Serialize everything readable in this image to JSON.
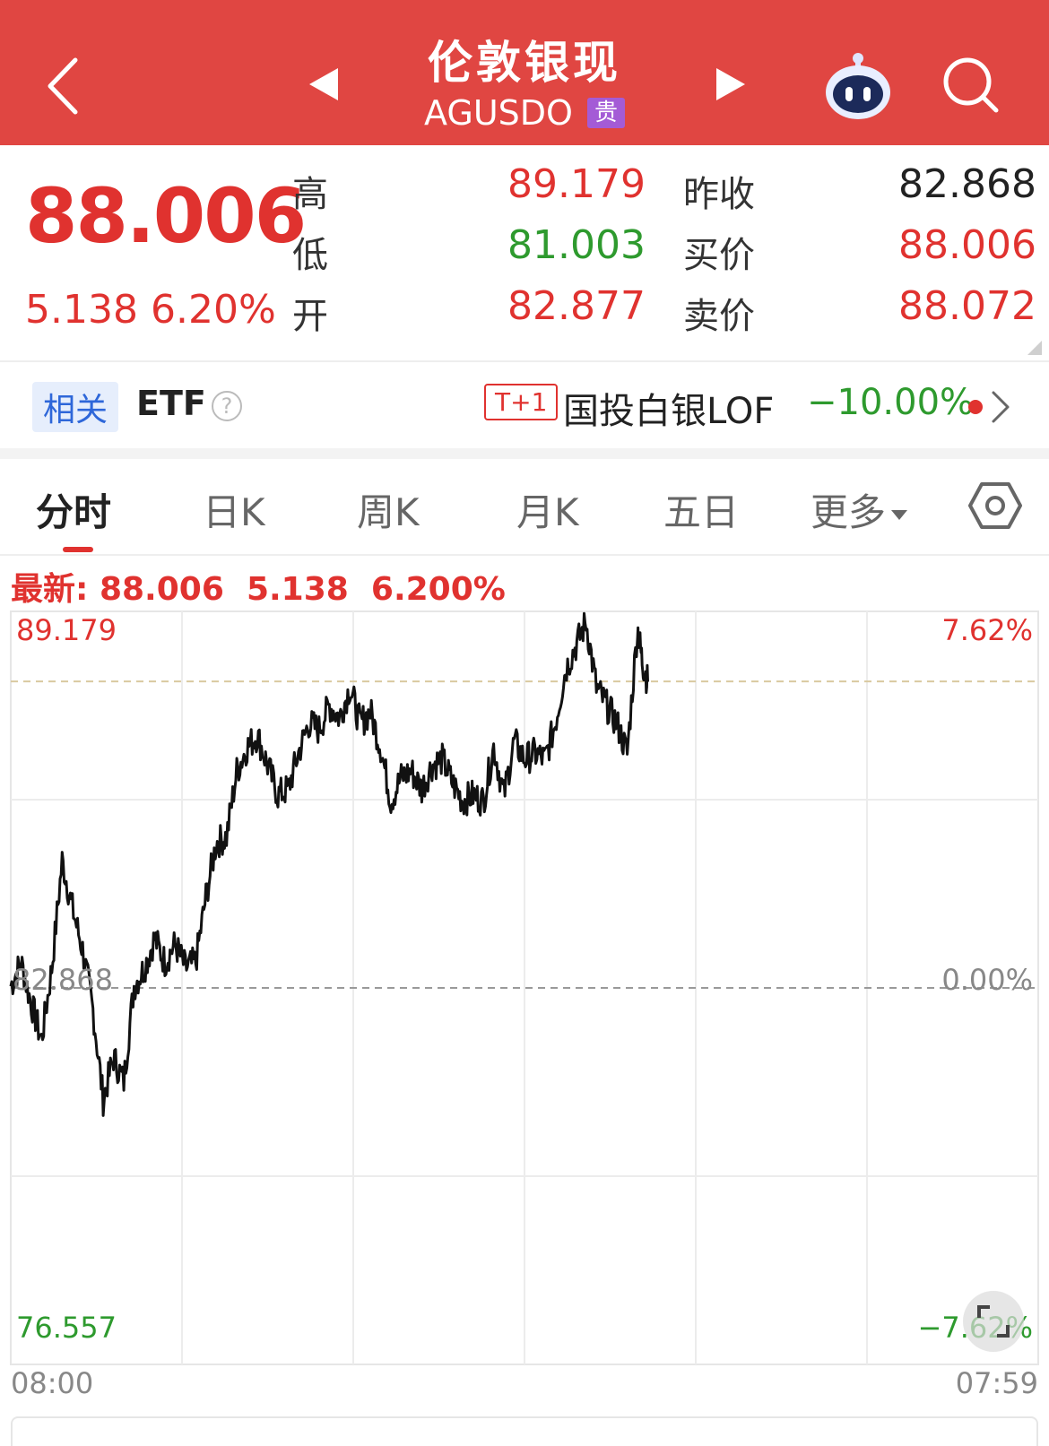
{
  "header": {
    "title": "伦敦银现",
    "code": "AGUSDO",
    "badge": "贵"
  },
  "quote": {
    "price": "88.006",
    "change": "5.138",
    "change_pct": "6.20%",
    "high_label": "高",
    "high": "89.179",
    "low_label": "低",
    "low": "81.003",
    "open_label": "开",
    "open": "82.877",
    "prev_close_label": "昨收",
    "prev_close": "82.868",
    "bid_label": "买价",
    "bid": "88.006",
    "ask_label": "卖价",
    "ask": "88.072"
  },
  "etf": {
    "related_tag": "相关",
    "label": "ETF",
    "help": "?",
    "t1_tag": "T+1",
    "fund_name": "国投白银LOF",
    "fund_change": "−10.00%"
  },
  "tabs": [
    {
      "label": "分时",
      "active": true
    },
    {
      "label": "日K",
      "active": false
    },
    {
      "label": "周K",
      "active": false
    },
    {
      "label": "月K",
      "active": false
    },
    {
      "label": "五日",
      "active": false
    },
    {
      "label": "更多",
      "active": false
    }
  ],
  "latest": {
    "label": "最新:",
    "price": "88.006",
    "change": "5.138",
    "change_pct": "6.200%"
  },
  "chart_data": {
    "type": "line",
    "y_max_label": "89.179",
    "y_min_label": "76.557",
    "y_ref_label": "82.868",
    "pct_max_label": "7.62%",
    "pct_ref_label": "0.00%",
    "pct_min_label": "−7.62%",
    "x_start_label": "08:00",
    "x_end_label": "07:59",
    "ylim": [
      76.557,
      89.179
    ],
    "reference": 82.868,
    "high_line": 88.006,
    "grid": true,
    "x_fraction": [
      0.0,
      0.01,
      0.02,
      0.03,
      0.04,
      0.05,
      0.06,
      0.07,
      0.08,
      0.09,
      0.1,
      0.11,
      0.12,
      0.13,
      0.14,
      0.15,
      0.16,
      0.17,
      0.18,
      0.19,
      0.2,
      0.21,
      0.22,
      0.23,
      0.24,
      0.25,
      0.26,
      0.27,
      0.28,
      0.29,
      0.3,
      0.31,
      0.32,
      0.33,
      0.34,
      0.35,
      0.36,
      0.37,
      0.38,
      0.39,
      0.4,
      0.41,
      0.42,
      0.43,
      0.44,
      0.45,
      0.46,
      0.47,
      0.48,
      0.49,
      0.5,
      0.51,
      0.52,
      0.53,
      0.54,
      0.55,
      0.56,
      0.57,
      0.58,
      0.59,
      0.6,
      0.61,
      0.615,
      0.62
    ],
    "values": [
      82.9,
      83.3,
      82.6,
      82.0,
      83.2,
      85.0,
      84.2,
      83.5,
      82.5,
      81.0,
      81.7,
      81.3,
      82.9,
      83.2,
      83.7,
      83.3,
      83.6,
      83.2,
      83.3,
      84.4,
      85.3,
      85.4,
      86.5,
      86.9,
      87.1,
      86.6,
      86.1,
      86.2,
      86.8,
      87.3,
      87.2,
      87.6,
      87.4,
      87.9,
      87.3,
      87.5,
      86.9,
      86.0,
      86.4,
      86.5,
      86.2,
      86.6,
      86.7,
      86.3,
      86.0,
      86.1,
      86.0,
      86.9,
      86.1,
      87.0,
      86.7,
      86.8,
      86.7,
      87.3,
      88.2,
      88.6,
      89.0,
      87.9,
      87.6,
      87.3,
      86.8,
      88.9,
      88.3,
      88.0
    ]
  }
}
